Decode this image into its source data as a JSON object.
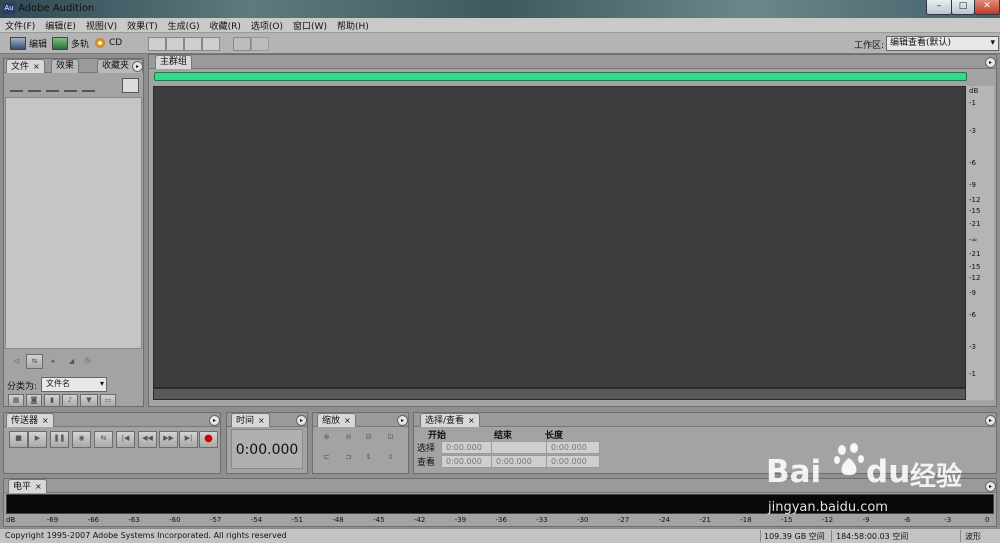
{
  "window": {
    "title": "Adobe Audition",
    "minimize": "–",
    "maximize": "□",
    "close": "✕",
    "app_icon": "Au"
  },
  "menu": [
    "文件(F)",
    "编辑(E)",
    "视图(V)",
    "效果(T)",
    "生成(G)",
    "收藏(R)",
    "选项(O)",
    "窗口(W)",
    "帮助(H)"
  ],
  "toolbar": {
    "edit_label": "编辑",
    "multitrack_label": "多轨",
    "cd_label": "CD",
    "workspace_label": "工作区:",
    "workspace_value": "编辑查看(默认)"
  },
  "files_panel": {
    "tabs": [
      "文件",
      "效果",
      "收藏夹"
    ],
    "sort_label": "分类为:",
    "sort_value": "文件名"
  },
  "main_panel": {
    "tab": "主群组",
    "db_unit": "dB",
    "db_ticks": [
      "-1",
      "-3",
      "-6",
      "-9",
      "-12",
      "-15",
      "-21",
      "-∞",
      "-21",
      "-15",
      "-12",
      "-9",
      "-6",
      "-3",
      "-1"
    ]
  },
  "transport_panel": {
    "tab": "传送器"
  },
  "time_panel": {
    "tab": "时间",
    "value": "0:00.000"
  },
  "zoom_panel": {
    "tab": "缩放"
  },
  "selection_panel": {
    "tab": "选择/查看",
    "col_start": "开始",
    "col_end": "结束",
    "col_length": "长度",
    "row_selection": "选择",
    "row_view": "查看",
    "sel_start": "0:00.000",
    "sel_end": "",
    "sel_length": "0:00.000",
    "view_start": "0:00.000",
    "view_end": "0:00.000",
    "view_length": "0:00.000"
  },
  "level_panel": {
    "tab": "电平",
    "ticks": [
      "dB",
      "-69",
      "-66",
      "-63",
      "-60",
      "-57",
      "-54",
      "-51",
      "-48",
      "-45",
      "-42",
      "-39",
      "-36",
      "-33",
      "-30",
      "-27",
      "-24",
      "-21",
      "-18",
      "-15",
      "-12",
      "-9",
      "-6",
      "-3",
      "0"
    ]
  },
  "status": {
    "copyright": "Copyright 1995-2007 Adobe Systems Incorporated. All rights reserved",
    "disk_free": "109.39 GB 空间",
    "time_free": "184:58:00.03 空间",
    "mode": "波形"
  },
  "watermark": {
    "brand_latin": "Bai",
    "brand_latin2": "du",
    "brand_cn": "经验",
    "url": "jingyan.baidu.com"
  },
  "colors": {
    "accent_green": "#33d98a",
    "editor_bg": "#3d3d3d",
    "record_red": "#cc0000"
  }
}
